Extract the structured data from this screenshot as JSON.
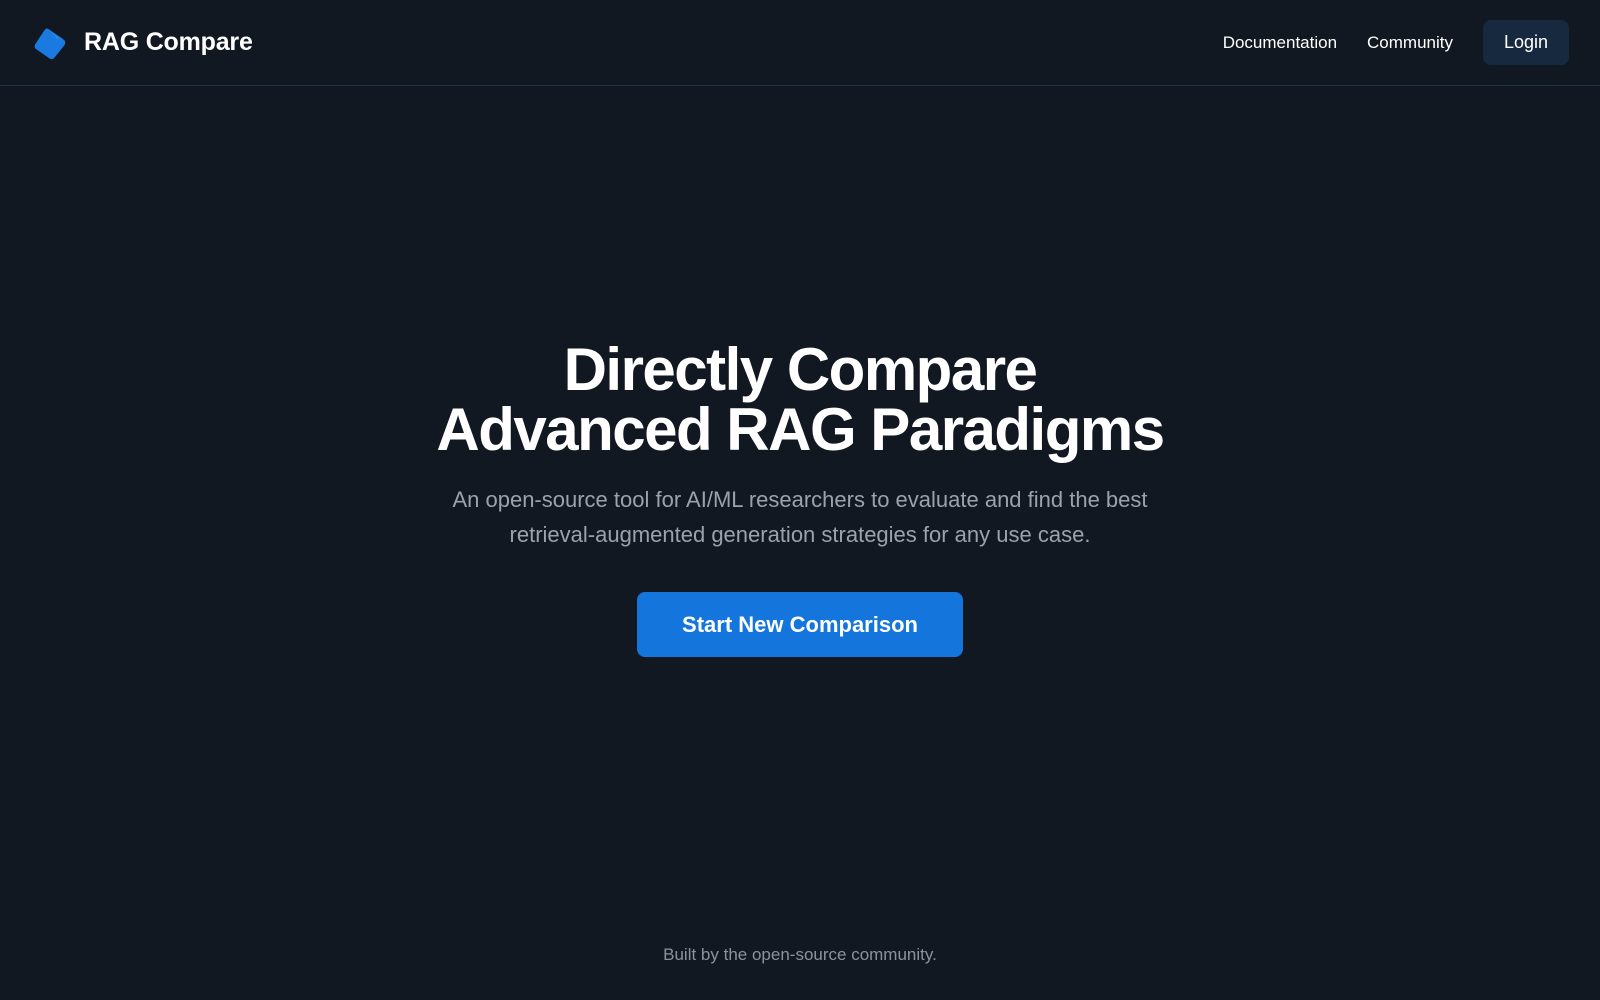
{
  "header": {
    "brand_name": "RAG Compare",
    "logo_icon": "tag-logo-icon",
    "nav": {
      "documentation_label": "Documentation",
      "community_label": "Community"
    },
    "login_label": "Login"
  },
  "hero": {
    "title_line1": "Directly Compare",
    "title_line2": "Advanced RAG Paradigms",
    "subtitle_line1": "An open-source tool for AI/ML researchers to evaluate and find the best",
    "subtitle_line2": "retrieval-augmented generation strategies for any use case.",
    "cta_label": "Start New Comparison"
  },
  "footer": {
    "text": "Built by the open-source community."
  },
  "colors": {
    "background": "#111822",
    "accent": "#1476dc",
    "login_bg": "#17293f",
    "muted_text": "#9aa3ad"
  }
}
